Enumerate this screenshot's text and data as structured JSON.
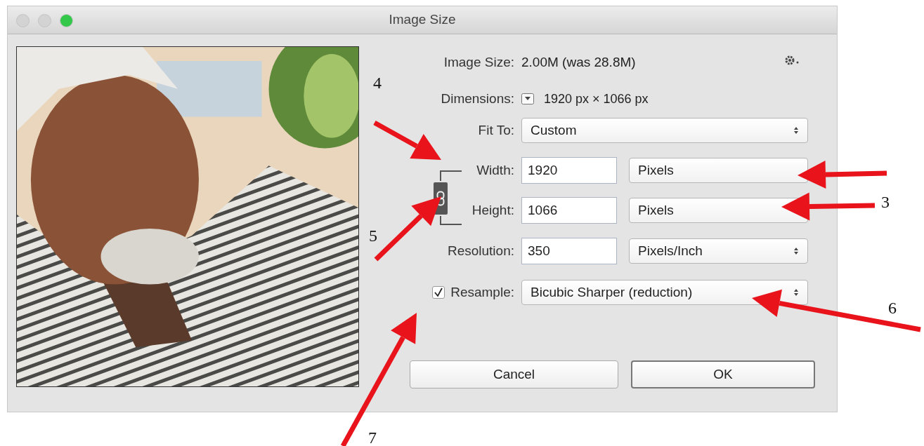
{
  "window": {
    "title": "Image Size",
    "buttons": [
      {
        "kind": "close",
        "enabled": false
      },
      {
        "kind": "minimize",
        "enabled": false
      },
      {
        "kind": "zoom",
        "enabled": true
      }
    ]
  },
  "image_size": {
    "label": "Image Size:",
    "value": "2.00M (was 28.8M)"
  },
  "dimensions": {
    "label": "Dimensions:",
    "value": "1920 px × 1066 px"
  },
  "fit_to": {
    "label": "Fit To:",
    "value": "Custom"
  },
  "width": {
    "label": "Width:",
    "value": "1920",
    "unit": "Pixels"
  },
  "height": {
    "label": "Height:",
    "value": "1066",
    "unit": "Pixels"
  },
  "constrain_proportions": {
    "on": true
  },
  "resolution": {
    "label": "Resolution:",
    "value": "350",
    "unit": "Pixels/Inch"
  },
  "resample": {
    "label": "Resample:",
    "checked": true,
    "value": "Bicubic Sharper (reduction)"
  },
  "buttons": [
    {
      "label": "Cancel",
      "default": false
    },
    {
      "label": "OK",
      "default": true
    }
  ],
  "annotations": [
    {
      "label": "4"
    },
    {
      "label": "3"
    },
    {
      "label": "5"
    },
    {
      "label": "6"
    },
    {
      "label": "7"
    }
  ]
}
